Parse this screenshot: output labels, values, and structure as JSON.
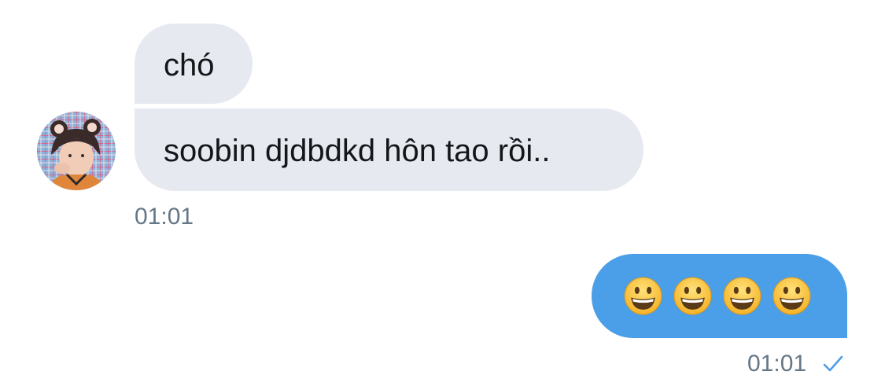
{
  "conversation": {
    "incoming": [
      {
        "text": "chó"
      },
      {
        "text": "soobin djdbdkd hôn tao rồi.."
      }
    ],
    "incoming_time": "01:01",
    "outgoing": {
      "emoji_name": "grinning-face",
      "emoji_count": 4
    },
    "outgoing_time": "01:01",
    "outgoing_status": "sent-check"
  },
  "colors": {
    "incoming_bubble": "#e6e9ef",
    "outgoing_bubble": "#4b9ee8",
    "timestamp": "#657786",
    "check": "#4b9ee8"
  }
}
